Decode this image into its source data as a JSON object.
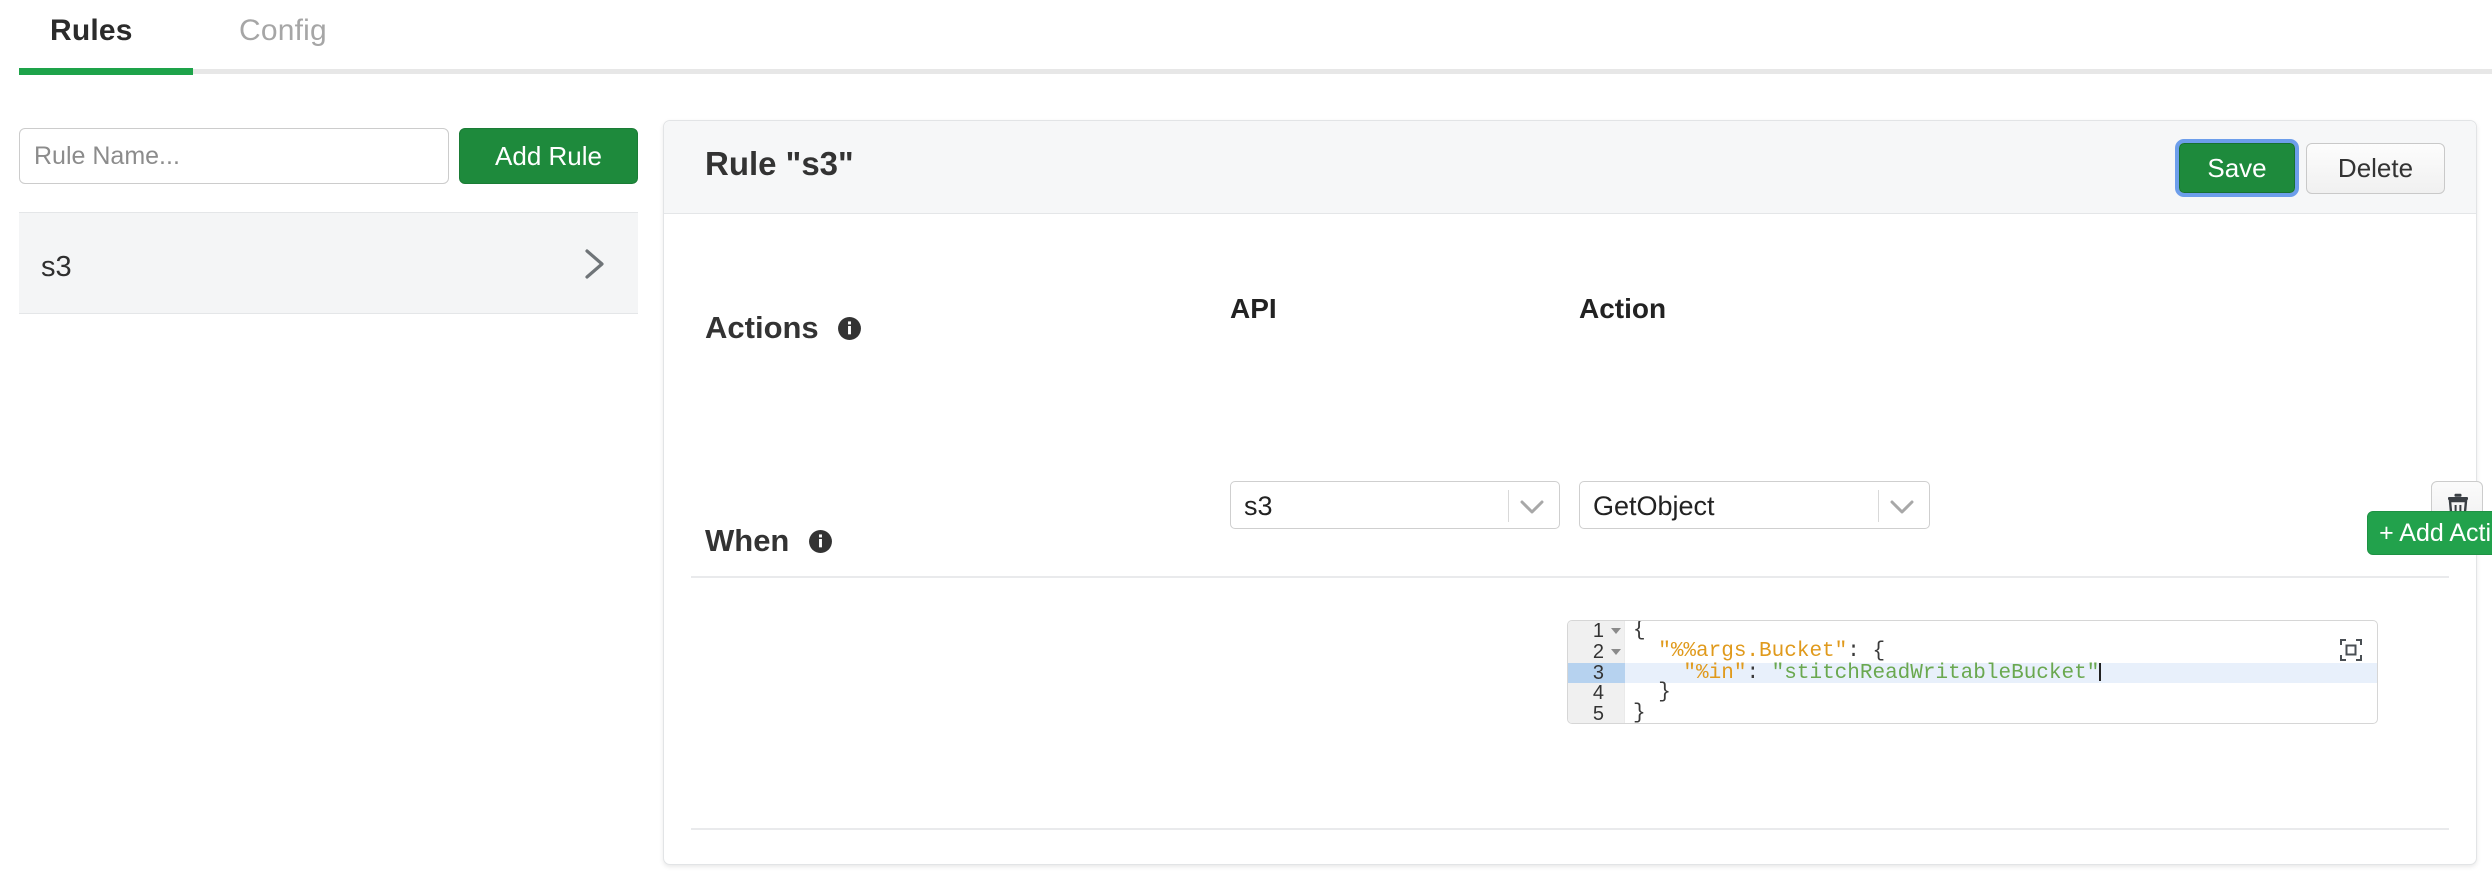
{
  "tabs": [
    {
      "id": "rules",
      "label": "Rules",
      "active": true
    },
    {
      "id": "config",
      "label": "Config",
      "active": false
    }
  ],
  "sidebar": {
    "rule_name_input": {
      "value": "",
      "placeholder": "Rule Name..."
    },
    "add_rule_label": "Add Rule",
    "rules": [
      {
        "name": "s3",
        "chevron": "chevron-right-icon"
      }
    ]
  },
  "card": {
    "title": "Rule \"s3\"",
    "save_label": "Save",
    "delete_label": "Delete",
    "sections": {
      "actions": {
        "label": "Actions",
        "info_icon": "info-icon",
        "api_label": "API",
        "action_label": "Action",
        "api_value": "s3",
        "action_value": "GetObject",
        "delete_action_icon": "trash-icon",
        "add_action_label": "+ Add Action"
      },
      "when": {
        "label": "When",
        "info_icon": "info-icon",
        "expand_icon": "expand-icon",
        "editor": {
          "active_line": 3,
          "lines": [
            {
              "num": "1",
              "foldable": true,
              "indent": "",
              "tokens": [
                {
                  "t": "{",
                  "c": "punct"
                }
              ]
            },
            {
              "num": "2",
              "foldable": true,
              "indent": "  ",
              "tokens": [
                {
                  "t": "\"%%args.Bucket\"",
                  "c": "key"
                },
                {
                  "t": ": {",
                  "c": "punct"
                }
              ]
            },
            {
              "num": "3",
              "foldable": false,
              "indent": "    ",
              "tokens": [
                {
                  "t": "\"%in\"",
                  "c": "key"
                },
                {
                  "t": ": ",
                  "c": "punct"
                },
                {
                  "t": "\"stitchReadWritableBucket\"",
                  "c": "string"
                }
              ],
              "caret_at_end": true
            },
            {
              "num": "4",
              "foldable": false,
              "indent": "  ",
              "tokens": [
                {
                  "t": "}",
                  "c": "punct"
                }
              ]
            },
            {
              "num": "5",
              "foldable": false,
              "indent": "",
              "tokens": [
                {
                  "t": "}",
                  "c": "punct"
                }
              ]
            }
          ]
        }
      }
    }
  },
  "colors": {
    "accent_green": "#1ea34a",
    "button_green": "#1e8a3c",
    "focus_blue": "#6d9eeb",
    "active_line": "#e8f0fb",
    "gutter_active": "#b6d2ef",
    "code_key": "#e09a1c",
    "code_string": "#6aa84f"
  }
}
